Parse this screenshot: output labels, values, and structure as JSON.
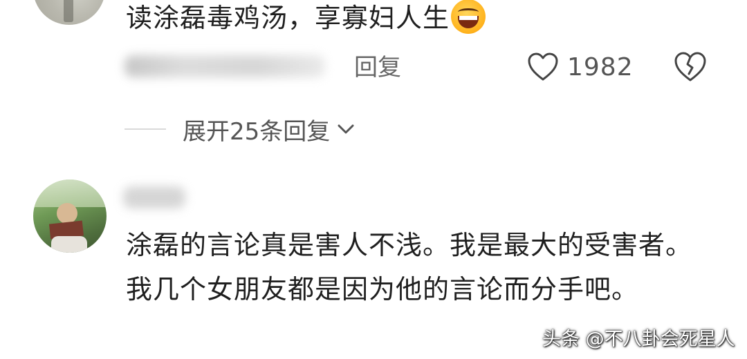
{
  "comment_1": {
    "text": "读涂磊毒鸡汤，享寡妇人生",
    "emoji": "laughing-squint-face",
    "reply_label": "回复",
    "like_count": "1982"
  },
  "expand_replies": {
    "label": "展开25条回复"
  },
  "comment_2": {
    "text": "涂磊的言论真是害人不浅。我是最大的受害者。我几个女朋友都是因为他的言论而分手吧。"
  },
  "watermark": {
    "text": "头条 @不八卦会死星人"
  },
  "icons": {
    "like": "heart-outline",
    "dislike": "broken-heart-outline",
    "expand": "chevron-down"
  },
  "colors": {
    "text": "#1f1f1f",
    "secondary": "#666666",
    "divider": "#d9d9d9"
  }
}
